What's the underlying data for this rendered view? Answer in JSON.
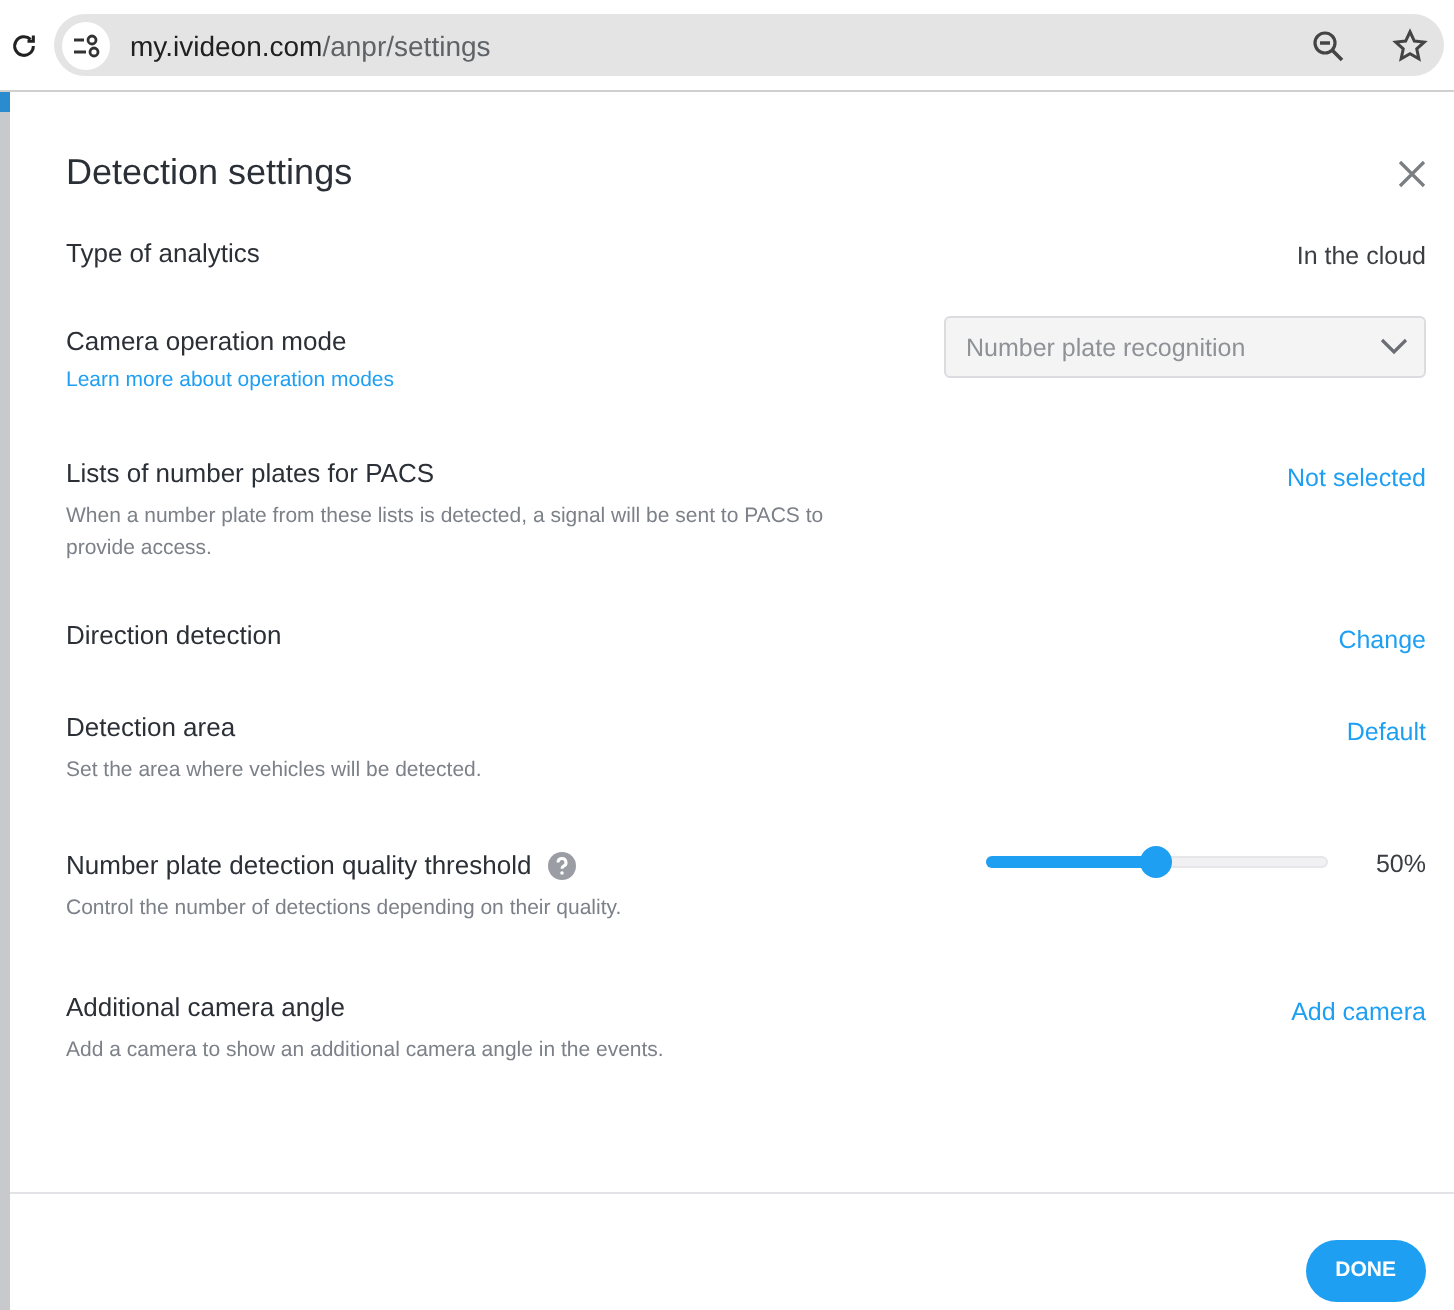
{
  "browser": {
    "url_host": "my.ivideon.com",
    "url_path": "/anpr/settings"
  },
  "dialog": {
    "title": "Detection settings",
    "rows": [
      {
        "kind": "text",
        "label": "Type of analytics",
        "value": "In the cloud"
      },
      {
        "kind": "select",
        "label": "Camera operation mode",
        "link": "Learn more about operation modes",
        "value": "Number plate recognition",
        "disabled": true
      },
      {
        "kind": "link",
        "label": "Lists of number plates for PACS",
        "description": "When a number plate from these lists is detected, a signal will be sent to PACS to provide access.",
        "value": "Not selected"
      },
      {
        "kind": "link",
        "label": "Direction detection",
        "value": "Change"
      },
      {
        "kind": "link",
        "label": "Detection area",
        "description": "Set the area where vehicles will be detected.",
        "value": "Default"
      },
      {
        "kind": "slider",
        "label": "Number plate detection quality threshold",
        "help": true,
        "description": "Control the number of detections depending on their quality.",
        "level": 0.5,
        "value": "50%"
      },
      {
        "kind": "link",
        "label": "Additional camera angle",
        "description": "Add a camera to show an additional camera angle in the events.",
        "value": "Add camera"
      }
    ],
    "done_button": "DONE"
  }
}
